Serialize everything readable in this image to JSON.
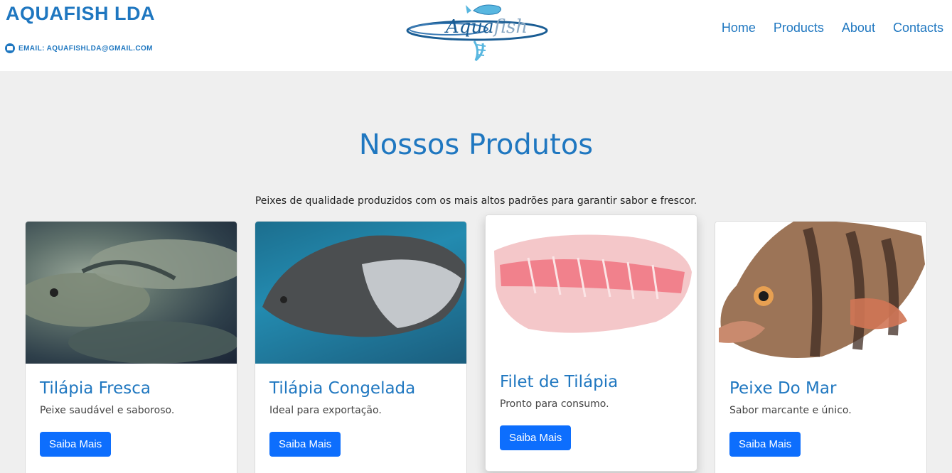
{
  "header": {
    "brand": "AQUAFISH LDA",
    "email": "EMAIL: AQUAFISHLDA@GMAIL.COM",
    "logo_text_a": "Aqua",
    "logo_text_b": "fish",
    "nav": [
      "Home",
      "Products",
      "About",
      "Contacts"
    ]
  },
  "products_section": {
    "title": "Nossos Produtos",
    "subtitle": "Peixes de qualidade produzidos com os mais altos padrões para garantir sabor e frescor."
  },
  "cards": [
    {
      "title": "Tilápia Fresca",
      "text": "Peixe saudável e saboroso.",
      "button": "Saiba Mais"
    },
    {
      "title": "Tilápia Congelada",
      "text": "Ideal para exportação.",
      "button": "Saiba Mais"
    },
    {
      "title": "Filet de Tilápia",
      "text": "Pronto para consumo.",
      "button": "Saiba Mais"
    },
    {
      "title": "Peixe Do Mar",
      "text": "Sabor marcante e único.",
      "button": "Saiba Mais"
    }
  ],
  "colors": {
    "brand": "#1f77c0",
    "button": "#0d6efd",
    "background": "#efefef"
  }
}
